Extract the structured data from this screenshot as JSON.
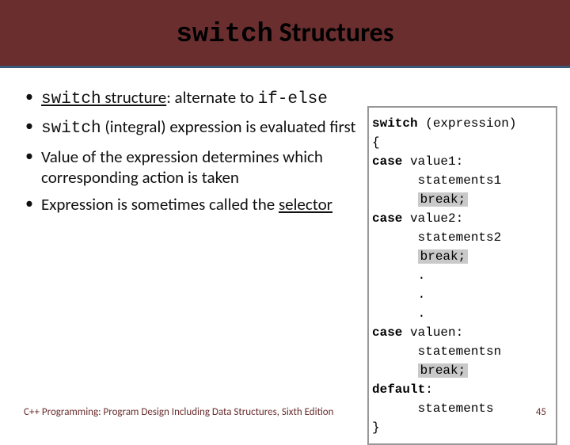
{
  "header": {
    "title_mono": "switch",
    "title_rest": " Structures"
  },
  "bullets": {
    "b1_mono": "switch",
    "b1_under": " structure",
    "b1_rest1": ": alternate to ",
    "b1_mono2": "if-else",
    "b2_mono": "switch",
    "b2_rest": " (integral) expression is evaluated first",
    "b3": "Value of the expression determines which corresponding action is taken",
    "b4_a": "Expression is sometimes called the ",
    "b4_under": "selector"
  },
  "code": {
    "l1a": "switch",
    "l1b": " (expression)",
    "l2": "{",
    "l3a": "case",
    "l3b": " value1:",
    "l4": "      statements1",
    "l5": "break;",
    "l6a": "case",
    "l6b": " value2:",
    "l7": "      statements2",
    "l8": "break;",
    "l9": "      .",
    "l10": "      .",
    "l11": "      .",
    "l12a": "case",
    "l12b": " valuen:",
    "l13": "      statementsn",
    "l14": "break;",
    "l15a": "default",
    "l15b": ":",
    "l16": "      statements",
    "l17": "}"
  },
  "footer": {
    "left": "C++ Programming: Program Design Including Data Structures, Sixth Edition",
    "right": "45"
  }
}
